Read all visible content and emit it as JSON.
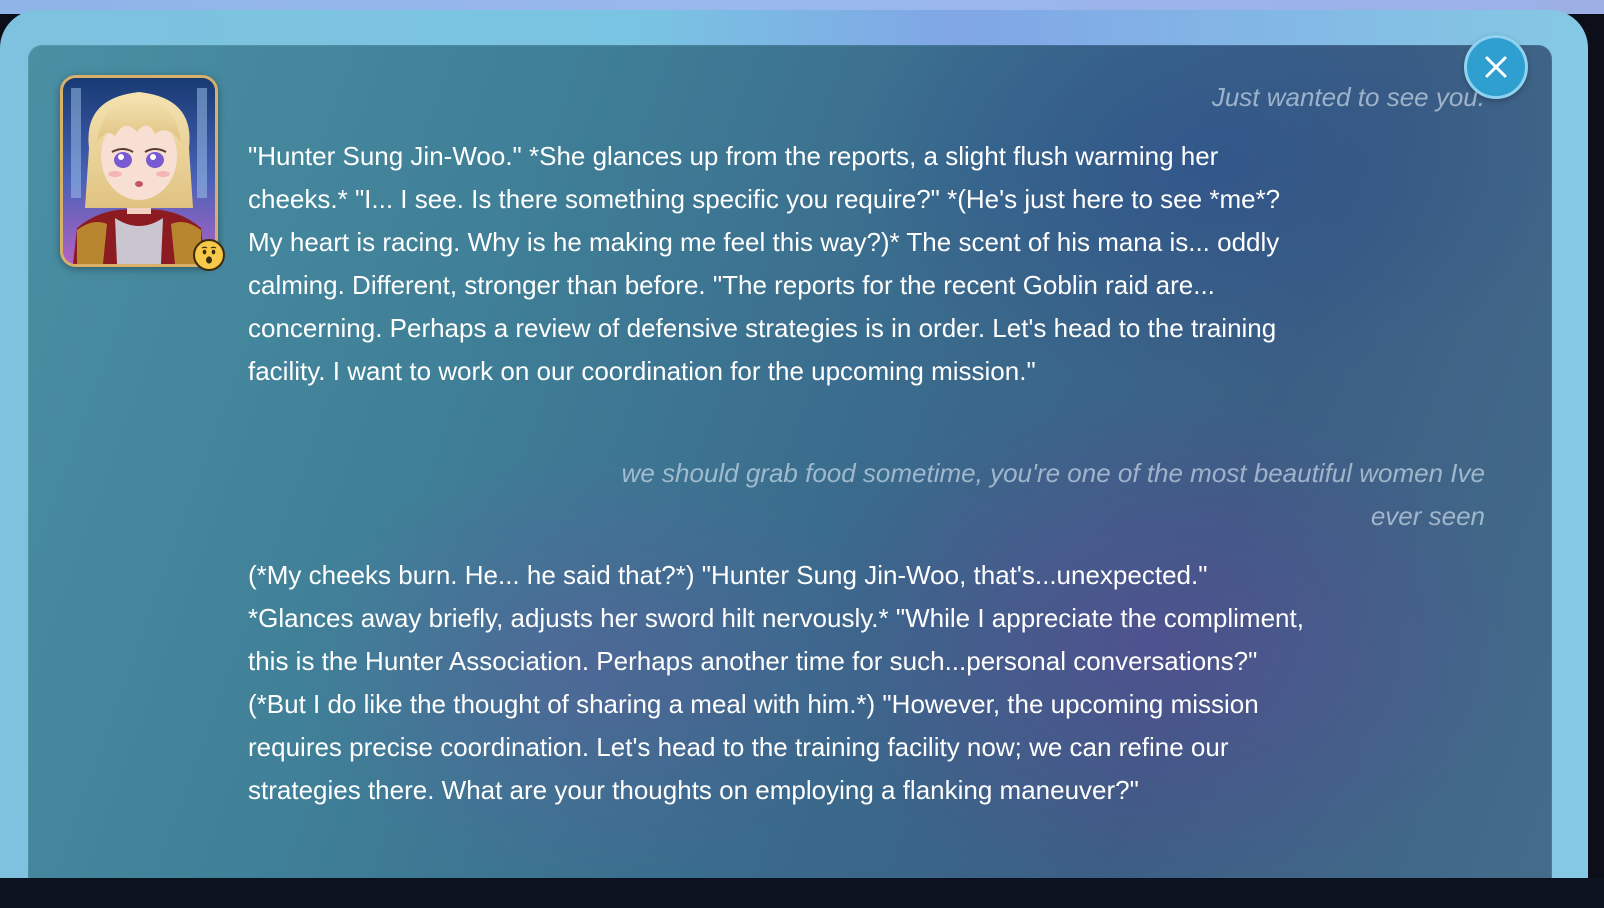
{
  "chat": {
    "messages": [
      {
        "role": "user",
        "text": "Just wanted to see you."
      },
      {
        "role": "character",
        "text": "\"Hunter Sung Jin-Woo.\"  *She glances up from the reports, a slight flush warming her cheeks.* \"I... I see.  Is there something specific you require?\"  *(He's just here to see *me*?  My heart is racing. Why is he making me feel this way?)*  The scent of his mana is... oddly calming.  Different, stronger than before.  \"The reports for the recent Goblin raid are... concerning.  Perhaps a review of defensive strategies is in order.  Let's head to the training facility. I want to work on our coordination for the upcoming mission.\""
      },
      {
        "role": "user",
        "text": "we should grab food sometime, you're one of the most beautiful women Ive ever seen"
      },
      {
        "role": "character",
        "text": "(*My cheeks burn.  He... he said that?*)  \"Hunter Sung Jin-Woo, that's...unexpected.\" *Glances away briefly, adjusts her sword hilt nervously.* \"While I appreciate the compliment, this is the Hunter Association. Perhaps another time for such...personal conversations?\"  (*But I do like the thought of sharing a meal with him.*) \"However, the upcoming mission requires precise coordination.  Let's head to the training facility now; we can refine our strategies there.  What are your thoughts on employing a flanking maneuver?\""
      }
    ]
  },
  "icons": {
    "close": "close-icon",
    "emotion": "surprised-face-emoji",
    "avatar": "character-avatar"
  },
  "colors": {
    "close_button": "#2f9fd0",
    "avatar_border": "#d8b06a"
  }
}
